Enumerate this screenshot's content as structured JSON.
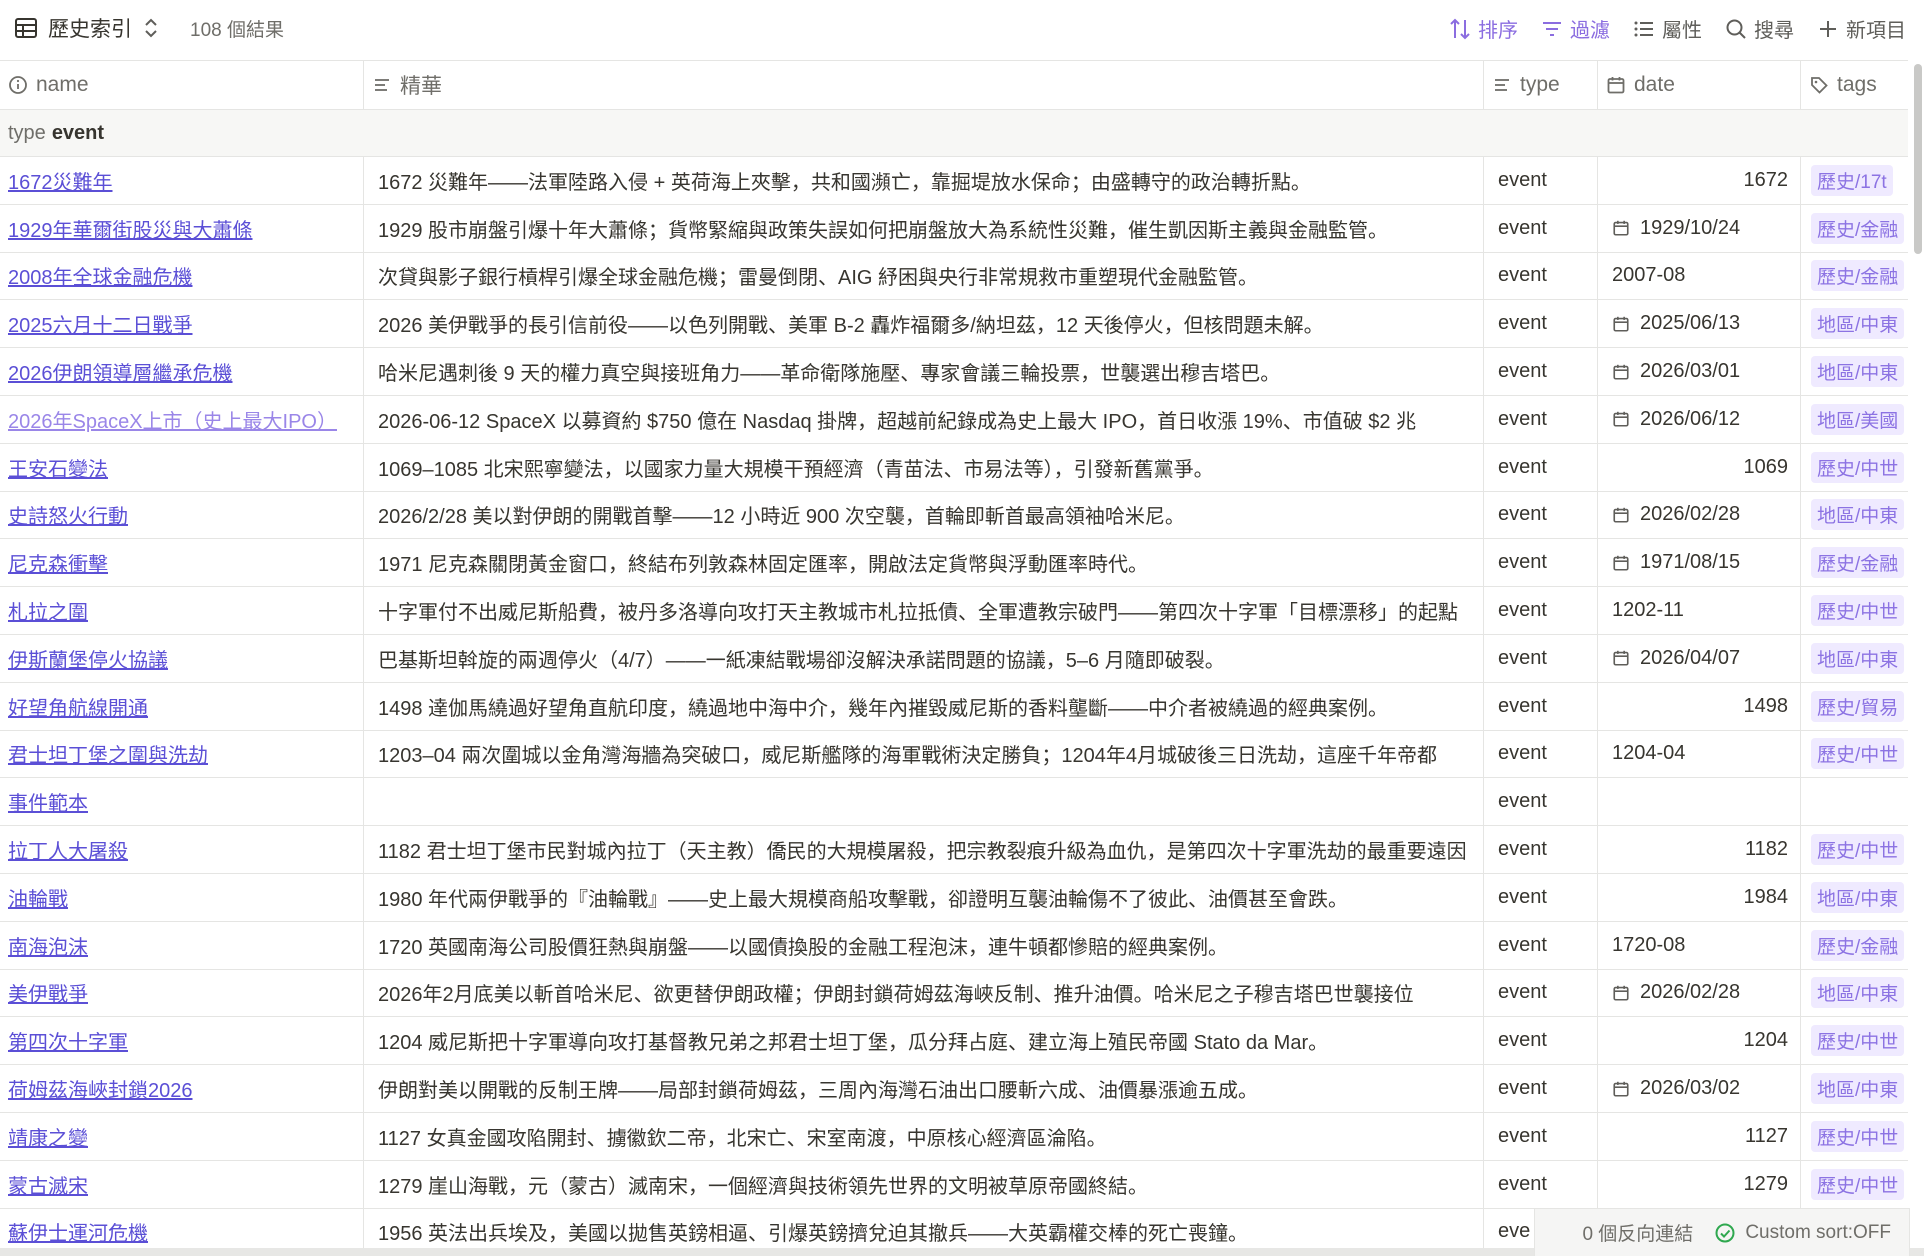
{
  "toolbar": {
    "view_title": "歷史索引",
    "result_count": "108 個結果",
    "sort_label": "排序",
    "filter_label": "過濾",
    "properties_label": "屬性",
    "search_label": "搜尋",
    "new_label": "新項目",
    "accent_color": "#8b6de0"
  },
  "columns": {
    "name": "name",
    "summary": "精華",
    "type": "type",
    "date": "date",
    "tags": "tags"
  },
  "group": {
    "label": "type",
    "value": "event"
  },
  "rows": [
    {
      "name": "1672災難年",
      "summary": "1672 災難年——法軍陸路入侵 + 英荷海上夾擊，共和國瀕亡，靠掘堤放水保命；由盛轉守的政治轉折點。",
      "type": "event",
      "date": "1672",
      "date_kind": "number",
      "tag": "歷史/17t"
    },
    {
      "name": "1929年華爾街股災與大蕭條",
      "summary": "1929 股市崩盤引爆十年大蕭條；貨幣緊縮與政策失誤如何把崩盤放大為系統性災難，催生凱因斯主義與金融監管。",
      "type": "event",
      "date": "1929/10/24",
      "date_kind": "calendar",
      "tag": "歷史/金融"
    },
    {
      "name": "2008年全球金融危機",
      "summary": "次貸與影子銀行槓桿引爆全球金融危機；雷曼倒閉、AIG 紓困與央行非常規救市重塑現代金融監管。",
      "type": "event",
      "date": "2007-08",
      "date_kind": "text",
      "tag": "歷史/金融"
    },
    {
      "name": "2025六月十二日戰爭",
      "summary": "2026 美伊戰爭的長引信前役——以色列開戰、美軍 B-2 轟炸福爾多/納坦茲，12 天後停火，但核問題未解。",
      "type": "event",
      "date": "2025/06/13",
      "date_kind": "calendar",
      "tag": "地區/中東"
    },
    {
      "name": "2026伊朗領導層繼承危機",
      "summary": "哈米尼遇刺後 9 天的權力真空與接班角力——革命衛隊施壓、專家會議三輪投票，世襲選出穆吉塔巴。",
      "type": "event",
      "date": "2026/03/01",
      "date_kind": "calendar",
      "tag": "地區/中東"
    },
    {
      "name": "2026年SpaceX上市（史上最大IPO）",
      "summary": "2026-06-12 SpaceX 以募資約 $750 億在 Nasdaq 掛牌，超越前紀錄成為史上最大 IPO，首日收漲 19%、市值破 $2 兆",
      "type": "event",
      "date": "2026/06/12",
      "date_kind": "calendar",
      "tag": "地區/美國",
      "faded": true
    },
    {
      "name": "王安石變法",
      "summary": "1069–1085 北宋熙寧變法，以國家力量大規模干預經濟（青苗法、市易法等），引發新舊黨爭。",
      "type": "event",
      "date": "1069",
      "date_kind": "number",
      "tag": "歷史/中世"
    },
    {
      "name": "史詩怒火行動",
      "summary": "2026/2/28 美以對伊朗的開戰首擊——12 小時近 900 次空襲，首輪即斬首最高領袖哈米尼。",
      "type": "event",
      "date": "2026/02/28",
      "date_kind": "calendar",
      "tag": "地區/中東"
    },
    {
      "name": "尼克森衝擊",
      "summary": "1971 尼克森關閉黃金窗口，終結布列敦森林固定匯率，開啟法定貨幣與浮動匯率時代。",
      "type": "event",
      "date": "1971/08/15",
      "date_kind": "calendar",
      "tag": "歷史/金融"
    },
    {
      "name": "札拉之圍",
      "summary": "十字軍付不出威尼斯船費，被丹多洛導向攻打天主教城市札拉抵債、全軍遭教宗破門——第四次十字軍「目標漂移」的起點",
      "type": "event",
      "date": "1202-11",
      "date_kind": "text",
      "tag": "歷史/中世"
    },
    {
      "name": "伊斯蘭堡停火協議",
      "summary": "巴基斯坦斡旋的兩週停火（4/7）——一紙凍結戰場卻沒解決承諾問題的協議，5–6 月隨即破裂。",
      "type": "event",
      "date": "2026/04/07",
      "date_kind": "calendar",
      "tag": "地區/中東"
    },
    {
      "name": "好望角航線開通",
      "summary": "1498 達伽馬繞過好望角直航印度，繞過地中海中介，幾年內摧毀威尼斯的香料壟斷——中介者被繞過的經典案例。",
      "type": "event",
      "date": "1498",
      "date_kind": "number",
      "tag": "歷史/貿易"
    },
    {
      "name": "君士坦丁堡之圍與洗劫",
      "summary": "1203–04 兩次圍城以金角灣海牆為突破口，威尼斯艦隊的海軍戰術決定勝負；1204年4月城破後三日洗劫，這座千年帝都",
      "type": "event",
      "date": "1204-04",
      "date_kind": "text",
      "tag": "歷史/中世"
    },
    {
      "name": "事件範本",
      "summary": "",
      "type": "event",
      "date": "",
      "date_kind": "text",
      "tag": ""
    },
    {
      "name": "拉丁人大屠殺",
      "summary": "1182 君士坦丁堡市民對城內拉丁（天主教）僑民的大規模屠殺，把宗教裂痕升級為血仇，是第四次十字軍洗劫的最重要遠因",
      "type": "event",
      "date": "1182",
      "date_kind": "number",
      "tag": "歷史/中世"
    },
    {
      "name": "油輪戰",
      "summary": "1980 年代兩伊戰爭的『油輪戰』——史上最大規模商船攻擊戰，卻證明互襲油輪傷不了彼此、油價甚至會跌。",
      "type": "event",
      "date": "1984",
      "date_kind": "number",
      "tag": "地區/中東"
    },
    {
      "name": "南海泡沫",
      "summary": "1720 英國南海公司股價狂熱與崩盤——以國債換股的金融工程泡沫，連牛頓都慘賠的經典案例。",
      "type": "event",
      "date": "1720-08",
      "date_kind": "text",
      "tag": "歷史/金融"
    },
    {
      "name": "美伊戰爭",
      "summary": "2026年2月底美以斬首哈米尼、欲更替伊朗政權；伊朗封鎖荷姆茲海峽反制、推升油價。哈米尼之子穆吉塔巴世襲接位",
      "type": "event",
      "date": "2026/02/28",
      "date_kind": "calendar",
      "tag": "地區/中東"
    },
    {
      "name": "第四次十字軍",
      "summary": "1204 威尼斯把十字軍導向攻打基督教兄弟之邦君士坦丁堡，瓜分拜占庭、建立海上殖民帝國 Stato da Mar。",
      "type": "event",
      "date": "1204",
      "date_kind": "number",
      "tag": "歷史/中世"
    },
    {
      "name": "荷姆茲海峽封鎖2026",
      "summary": "伊朗對美以開戰的反制王牌——局部封鎖荷姆茲，三周內海灣石油出口腰斬六成、油價暴漲逾五成。",
      "type": "event",
      "date": "2026/03/02",
      "date_kind": "calendar",
      "tag": "地區/中東"
    },
    {
      "name": "靖康之變",
      "summary": "1127 女真金國攻陷開封、擄徽欽二帝，北宋亡、宋室南渡，中原核心經濟區淪陷。",
      "type": "event",
      "date": "1127",
      "date_kind": "number",
      "tag": "歷史/中世"
    },
    {
      "name": "蒙古滅宋",
      "summary": "1279 崖山海戰，元（蒙古）滅南宋，一個經濟與技術領先世界的文明被草原帝國終結。",
      "type": "event",
      "date": "1279",
      "date_kind": "number",
      "tag": "歷史/中世"
    },
    {
      "name": "蘇伊士運河危機",
      "summary": "1956 英法出兵埃及，美國以拋售英鎊相逼、引爆英鎊擠兌迫其撤兵——大英霸權交棒的死亡喪鐘。",
      "type": "eve",
      "date": "",
      "date_kind": "text",
      "tag": ""
    }
  ],
  "status": {
    "backlinks": "0 個反向連結",
    "custom_sort": "Custom sort:OFF"
  }
}
